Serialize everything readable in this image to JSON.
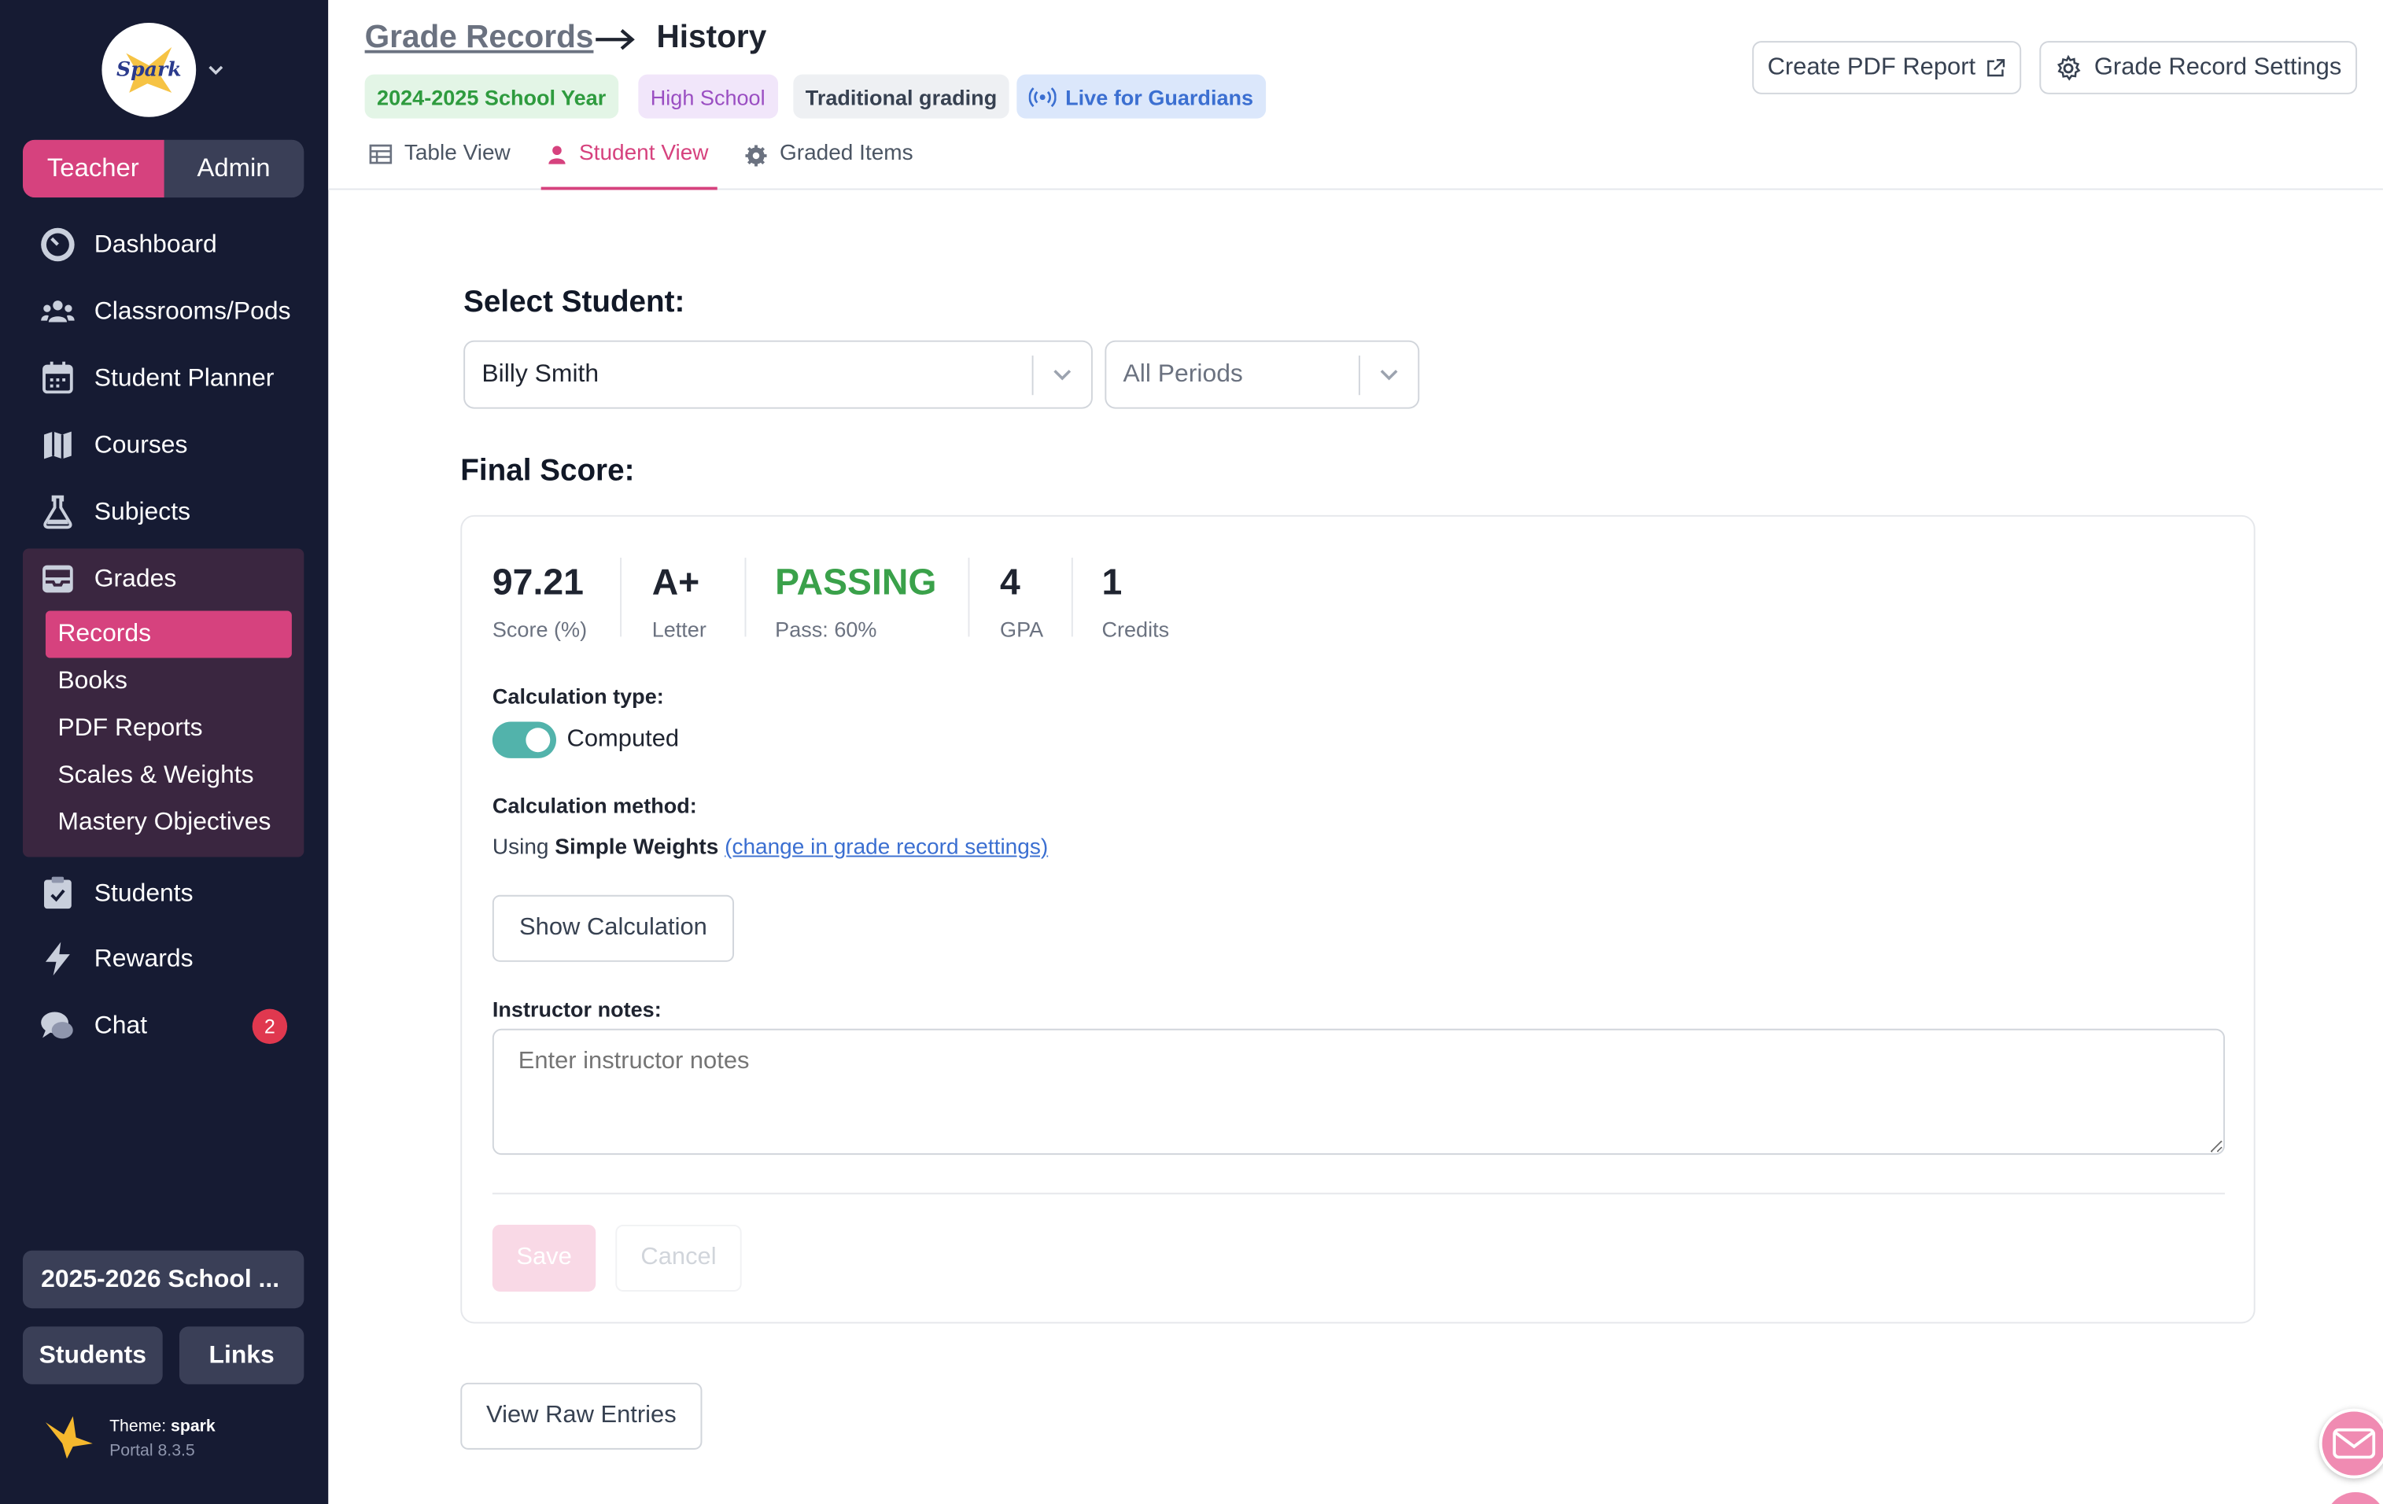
{
  "sidebar": {
    "logo_text": "Spark",
    "roles": [
      "Teacher",
      "Admin"
    ],
    "active_role": "Teacher",
    "nav": {
      "dashboard": "Dashboard",
      "classrooms": "Classrooms/Pods",
      "planner": "Student Planner",
      "courses": "Courses",
      "subjects": "Subjects",
      "grades": "Grades",
      "students": "Students",
      "rewards": "Rewards",
      "chat": "Chat"
    },
    "grades_sub": [
      "Records",
      "Books",
      "PDF Reports",
      "Scales & Weights",
      "Mastery Objectives"
    ],
    "chat_badge": "2",
    "school_year": "2025-2026 School ...",
    "students_btn": "Students",
    "links_btn": "Links",
    "theme_label": "Theme:",
    "theme_name": "spark",
    "portal_version": "Portal 8.3.5"
  },
  "header": {
    "breadcrumb_parent": "Grade Records",
    "breadcrumb_current": "History",
    "tags": {
      "year": "2024-2025 School Year",
      "level": "High School",
      "grading": "Traditional grading",
      "live": "Live for Guardians"
    },
    "create_pdf": "Create PDF Report",
    "settings": "Grade Record Settings",
    "tabs": [
      "Table View",
      "Student View",
      "Graded Items"
    ],
    "active_tab": "Student View"
  },
  "main": {
    "select_student_label": "Select Student:",
    "student_value": "Billy Smith",
    "period_value": "All Periods",
    "final_score_label": "Final Score:",
    "stats": [
      {
        "value": "97.21",
        "label": "Score (%)"
      },
      {
        "value": "A+",
        "label": "Letter"
      },
      {
        "value": "PASSING",
        "label": "Pass: 60%"
      },
      {
        "value": "4",
        "label": "GPA"
      },
      {
        "value": "1",
        "label": "Credits"
      }
    ],
    "calc_type_label": "Calculation type:",
    "calc_type_value": "Computed",
    "calc_type_on": true,
    "calc_method_label": "Calculation method:",
    "calc_method_prefix": "Using",
    "calc_method_name": "Simple Weights",
    "calc_method_link": "(change in grade record settings)",
    "show_calc": "Show Calculation",
    "notes_label": "Instructor notes:",
    "notes_placeholder": "Enter instructor notes",
    "save": "Save",
    "cancel": "Cancel",
    "view_raw": "View Raw Entries"
  },
  "colors": {
    "sidebar_bg": "#161b33",
    "accent_pink": "#d6427e",
    "passing_green": "#3aa14a",
    "toggle_teal": "#52b3ab",
    "link_blue": "#3b6fd1"
  }
}
